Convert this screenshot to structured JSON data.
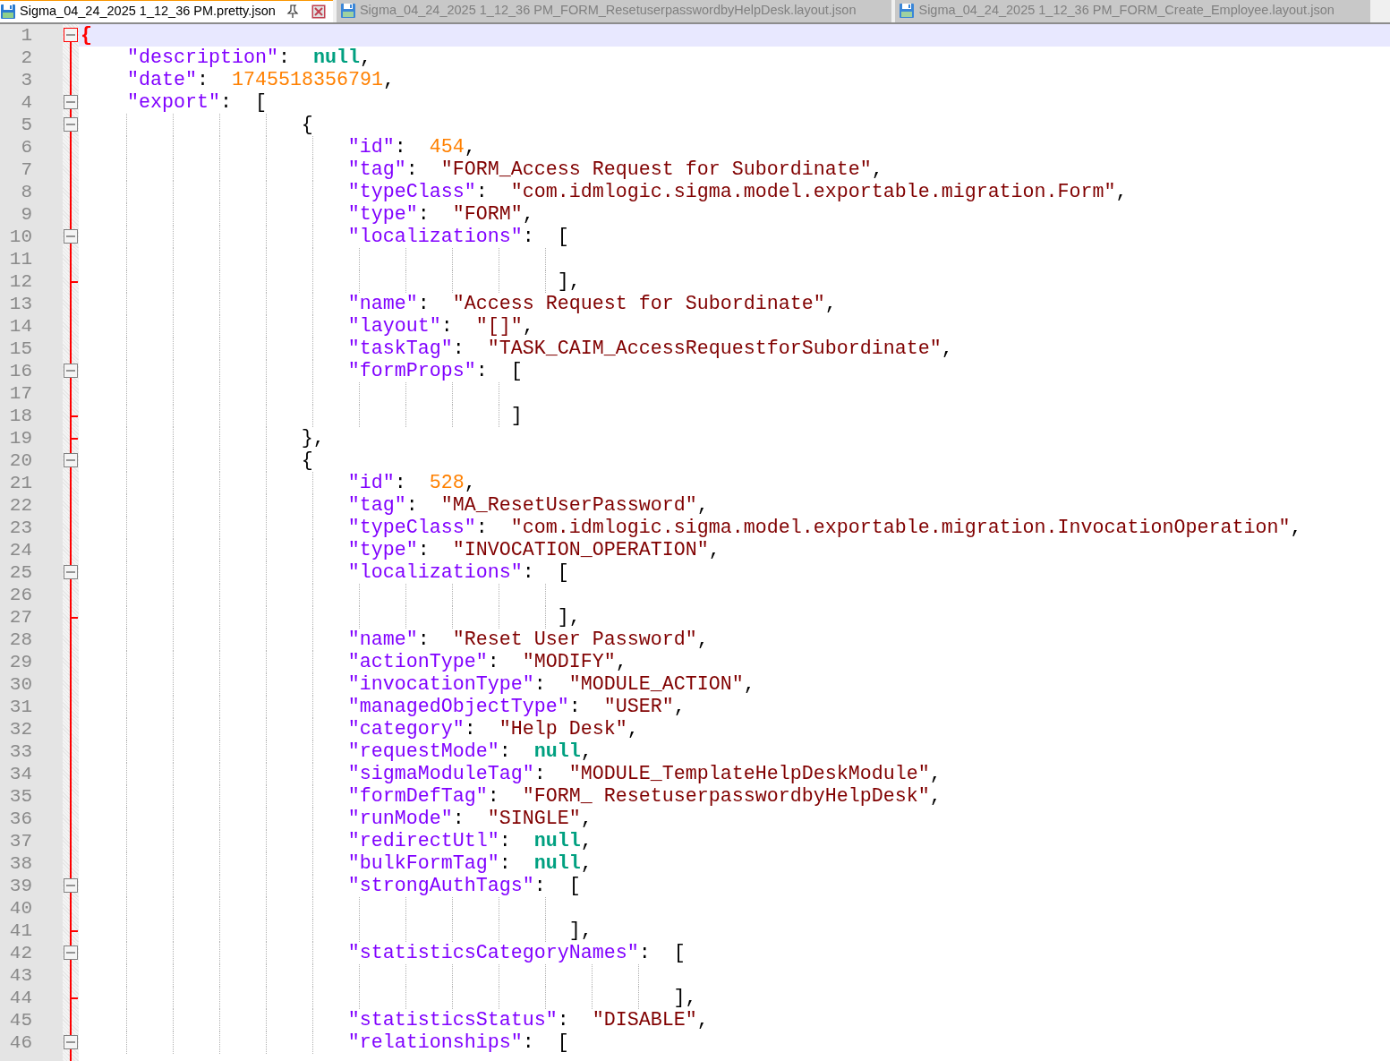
{
  "tabs": [
    {
      "label": "Sigma_04_24_2025 1_12_36 PM.pretty.json",
      "selected": true
    },
    {
      "label": "Sigma_04_24_2025 1_12_36 PM_FORM_ResetuserpasswordbyHelpDesk.layout.json",
      "selected": false
    },
    {
      "label": "Sigma_04_24_2025 1_12_36 PM_FORM_Create_Employee.layout.json",
      "selected": false
    }
  ],
  "lines": [
    {
      "number": "1",
      "code": "{",
      "fold_open": true,
      "fold_end": false,
      "current": true
    },
    {
      "number": "2",
      "code": "    \"description\":  null,",
      "fold_open": false,
      "fold_end": false,
      "current": false
    },
    {
      "number": "3",
      "code": "    \"date\":  1745518356791,",
      "fold_open": false,
      "fold_end": false,
      "current": false
    },
    {
      "number": "4",
      "code": "    \"export\":  [",
      "fold_open": true,
      "fold_end": false,
      "current": false
    },
    {
      "number": "5",
      "code": "                   {",
      "fold_open": true,
      "fold_end": false,
      "current": false
    },
    {
      "number": "6",
      "code": "                       \"id\":  454,",
      "fold_open": false,
      "fold_end": false,
      "current": false
    },
    {
      "number": "7",
      "code": "                       \"tag\":  \"FORM_Access Request for Subordinate\",",
      "fold_open": false,
      "fold_end": false,
      "current": false
    },
    {
      "number": "8",
      "code": "                       \"typeClass\":  \"com.idmlogic.sigma.model.exportable.migration.Form\",",
      "fold_open": false,
      "fold_end": false,
      "current": false
    },
    {
      "number": "9",
      "code": "                       \"type\":  \"FORM\",",
      "fold_open": false,
      "fold_end": false,
      "current": false
    },
    {
      "number": "10",
      "code": "                       \"localizations\":  [",
      "fold_open": true,
      "fold_end": false,
      "current": false
    },
    {
      "number": "11",
      "fold_open": false,
      "fold_end": false,
      "current": false
    },
    {
      "number": "12",
      "code": "                                         ],",
      "fold_open": false,
      "fold_end": true,
      "current": false
    },
    {
      "number": "13",
      "code": "                       \"name\":  \"Access Request for Subordinate\",",
      "fold_open": false,
      "fold_end": false,
      "current": false
    },
    {
      "number": "14",
      "code": "                       \"layout\":  \"[]\",",
      "fold_open": false,
      "fold_end": false,
      "current": false
    },
    {
      "number": "15",
      "code": "                       \"taskTag\":  \"TASK_CAIM_AccessRequestforSubordinate\",",
      "fold_open": false,
      "fold_end": false,
      "current": false
    },
    {
      "number": "16",
      "code": "                       \"formProps\":  [",
      "fold_open": true,
      "fold_end": false,
      "current": false
    },
    {
      "number": "17",
      "fold_open": false,
      "fold_end": false,
      "current": false
    },
    {
      "number": "18",
      "code": "                                     ]",
      "fold_open": false,
      "fold_end": true,
      "current": false
    },
    {
      "number": "19",
      "code": "                   },",
      "fold_open": false,
      "fold_end": true,
      "current": false
    },
    {
      "number": "20",
      "code": "                   {",
      "fold_open": true,
      "fold_end": false,
      "current": false
    },
    {
      "number": "21",
      "code": "                       \"id\":  528,",
      "fold_open": false,
      "fold_end": false,
      "current": false
    },
    {
      "number": "22",
      "code": "                       \"tag\":  \"MA_ResetUserPassword\",",
      "fold_open": false,
      "fold_end": false,
      "current": false
    },
    {
      "number": "23",
      "code": "                       \"typeClass\":  \"com.idmlogic.sigma.model.exportable.migration.InvocationOperation\",",
      "fold_open": false,
      "fold_end": false,
      "current": false
    },
    {
      "number": "24",
      "code": "                       \"type\":  \"INVOCATION_OPERATION\",",
      "fold_open": false,
      "fold_end": false,
      "current": false
    },
    {
      "number": "25",
      "code": "                       \"localizations\":  [",
      "fold_open": true,
      "fold_end": false,
      "current": false
    },
    {
      "number": "26",
      "fold_open": false,
      "fold_end": false,
      "current": false
    },
    {
      "number": "27",
      "code": "                                         ],",
      "fold_open": false,
      "fold_end": true,
      "current": false
    },
    {
      "number": "28",
      "code": "                       \"name\":  \"Reset User Password\",",
      "fold_open": false,
      "fold_end": false,
      "current": false
    },
    {
      "number": "29",
      "code": "                       \"actionType\":  \"MODIFY\",",
      "fold_open": false,
      "fold_end": false,
      "current": false
    },
    {
      "number": "30",
      "code": "                       \"invocationType\":  \"MODULE_ACTION\",",
      "fold_open": false,
      "fold_end": false,
      "current": false
    },
    {
      "number": "31",
      "code": "                       \"managedObjectType\":  \"USER\",",
      "fold_open": false,
      "fold_end": false,
      "current": false
    },
    {
      "number": "32",
      "code": "                       \"category\":  \"Help Desk\",",
      "fold_open": false,
      "fold_end": false,
      "current": false
    },
    {
      "number": "33",
      "code": "                       \"requestMode\":  null,",
      "fold_open": false,
      "fold_end": false,
      "current": false
    },
    {
      "number": "34",
      "code": "                       \"sigmaModuleTag\":  \"MODULE_TemplateHelpDeskModule\",",
      "fold_open": false,
      "fold_end": false,
      "current": false
    },
    {
      "number": "35",
      "code": "                       \"formDefTag\":  \"FORM_ ResetuserpasswordbyHelpDesk\",",
      "fold_open": false,
      "fold_end": false,
      "current": false
    },
    {
      "number": "36",
      "code": "                       \"runMode\":  \"SINGLE\",",
      "fold_open": false,
      "fold_end": false,
      "current": false
    },
    {
      "number": "37",
      "code": "                       \"redirectUtl\":  null,",
      "fold_open": false,
      "fold_end": false,
      "current": false
    },
    {
      "number": "38",
      "code": "                       \"bulkFormTag\":  null,",
      "fold_open": false,
      "fold_end": false,
      "current": false
    },
    {
      "number": "39",
      "code": "                       \"strongAuthTags\":  [",
      "fold_open": true,
      "fold_end": false,
      "current": false
    },
    {
      "number": "40",
      "fold_open": false,
      "fold_end": false,
      "current": false
    },
    {
      "number": "41",
      "code": "                                          ],",
      "fold_open": false,
      "fold_end": true,
      "current": false
    },
    {
      "number": "42",
      "code": "                       \"statisticsCategoryNames\":  [",
      "fold_open": true,
      "fold_end": false,
      "current": false
    },
    {
      "number": "43",
      "fold_open": false,
      "fold_end": false,
      "current": false
    },
    {
      "number": "44",
      "code": "                                                   ],",
      "fold_open": false,
      "fold_end": true,
      "current": false
    },
    {
      "number": "45",
      "code": "                       \"statisticsStatus\":  \"DISABLE\",",
      "fold_open": false,
      "fold_end": false,
      "current": false
    },
    {
      "number": "46",
      "code": "                       \"relationships\":  [",
      "fold_open": true,
      "fold_end": false,
      "current": false
    }
  ]
}
